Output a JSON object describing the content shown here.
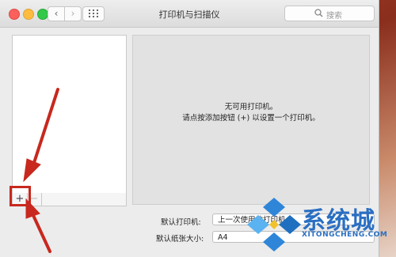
{
  "window": {
    "title": "打印机与扫描仪",
    "search_placeholder": "搜索",
    "nav_back": "‹",
    "nav_forward": "›"
  },
  "printer_list": {
    "add_label": "+",
    "remove_label": "−"
  },
  "detail": {
    "message_line1": "无可用打印机。",
    "message_line2": "请点按添加按钮 (+) 以设置一个打印机。"
  },
  "settings": {
    "default_printer_label": "默认打印机:",
    "default_printer_value": "上一次使用的打印机",
    "paper_size_label": "默认纸张大小:",
    "paper_size_value": "A4"
  },
  "watermark": {
    "name": "系统城",
    "domain": "XITONGCHENG.COM"
  },
  "colors": {
    "annotation": "#c8281e",
    "watermark": "#2a6fc2"
  }
}
